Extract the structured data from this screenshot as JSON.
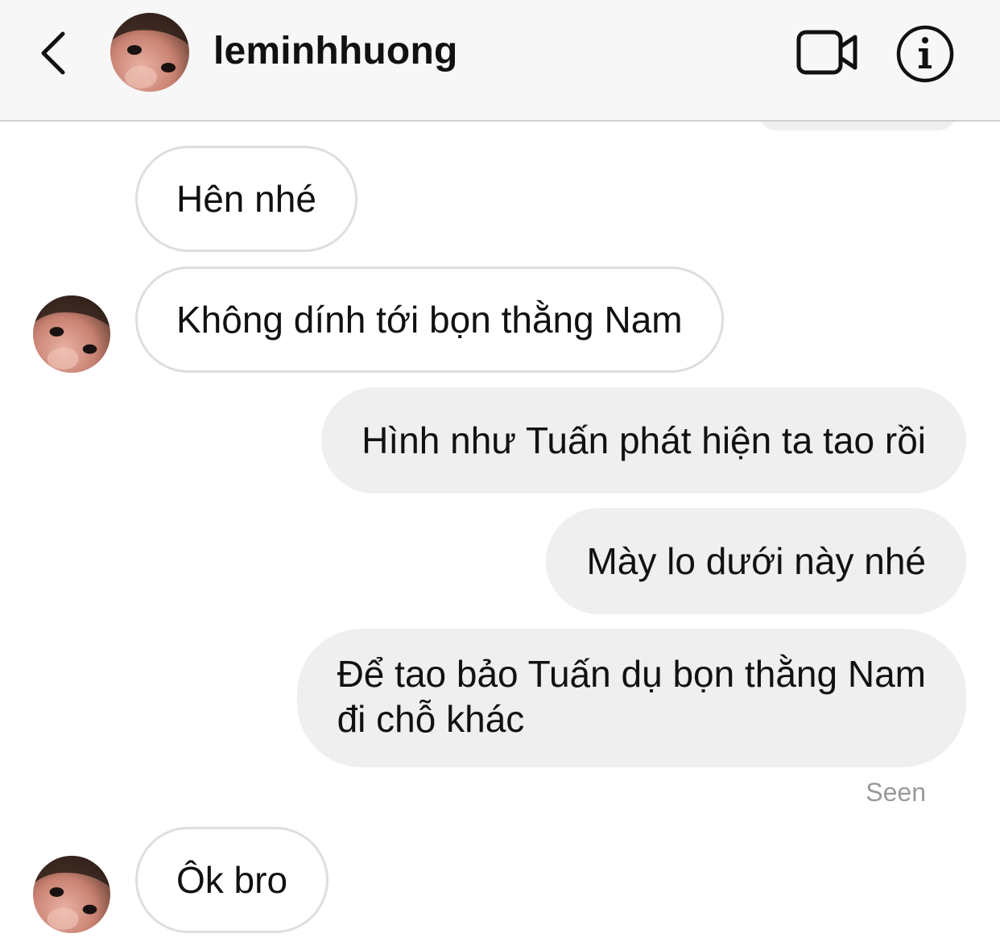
{
  "header": {
    "username": "leminhhuong",
    "back_icon": "chevron-left-icon",
    "video_icon": "video-camera-icon",
    "info_icon": "info-icon"
  },
  "messages": [
    {
      "direction": "incoming",
      "text": "Hên nhé",
      "show_avatar": false
    },
    {
      "direction": "incoming",
      "text": "Không dính tới bọn thằng Nam",
      "show_avatar": true
    },
    {
      "direction": "outgoing",
      "text": "Hình như Tuấn phát hiện ta tao rồi"
    },
    {
      "direction": "outgoing",
      "text": "Mày lo dưới này nhé"
    },
    {
      "direction": "outgoing",
      "lines": [
        "Để tao bảo Tuấn dụ bọn thằng Nam",
        "đi chỗ khác"
      ]
    },
    {
      "direction": "incoming",
      "text": "Ôk bro",
      "show_avatar": true
    }
  ],
  "status": {
    "seen": "Seen"
  },
  "colors": {
    "header_bg": "#f7f7f7",
    "outgoing_bubble": "#efefef",
    "incoming_border": "#dedede",
    "seen_text": "#9a9a9a"
  }
}
